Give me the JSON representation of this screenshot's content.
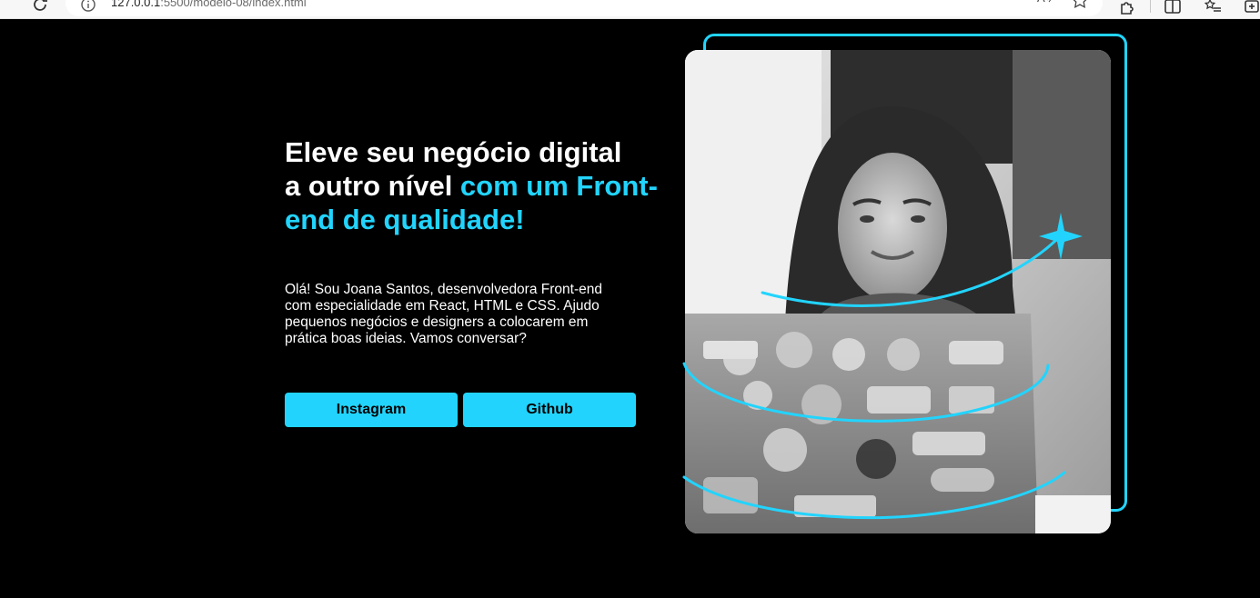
{
  "browser": {
    "url_host": "127.0.0.1",
    "url_rest": ":5500/modelo-08/index.html",
    "icons": [
      "reload-icon",
      "info-icon",
      "read-aloud-icon",
      "star-icon",
      "extensions-icon",
      "split-screen-icon",
      "favorites-icon",
      "collections-icon"
    ]
  },
  "hero": {
    "title_line1": "Eleve seu negócio digital",
    "title_line2_start": "a outro nível ",
    "title_accent": "com um Front-end de qualidade!",
    "description": "Olá! Sou Joana Santos, desenvolvedora Front-end com especialidade em React, HTML e CSS. Ajudo pequenos negócios e designers a colocarem em prática boas ideias. Vamos conversar?"
  },
  "buttons": {
    "instagram": "Instagram",
    "github": "Github"
  },
  "photo": {
    "icon": "woman-with-laptop-photo"
  },
  "colors": {
    "accent": "#22d4fd",
    "background": "#000000",
    "text": "#ffffff"
  }
}
